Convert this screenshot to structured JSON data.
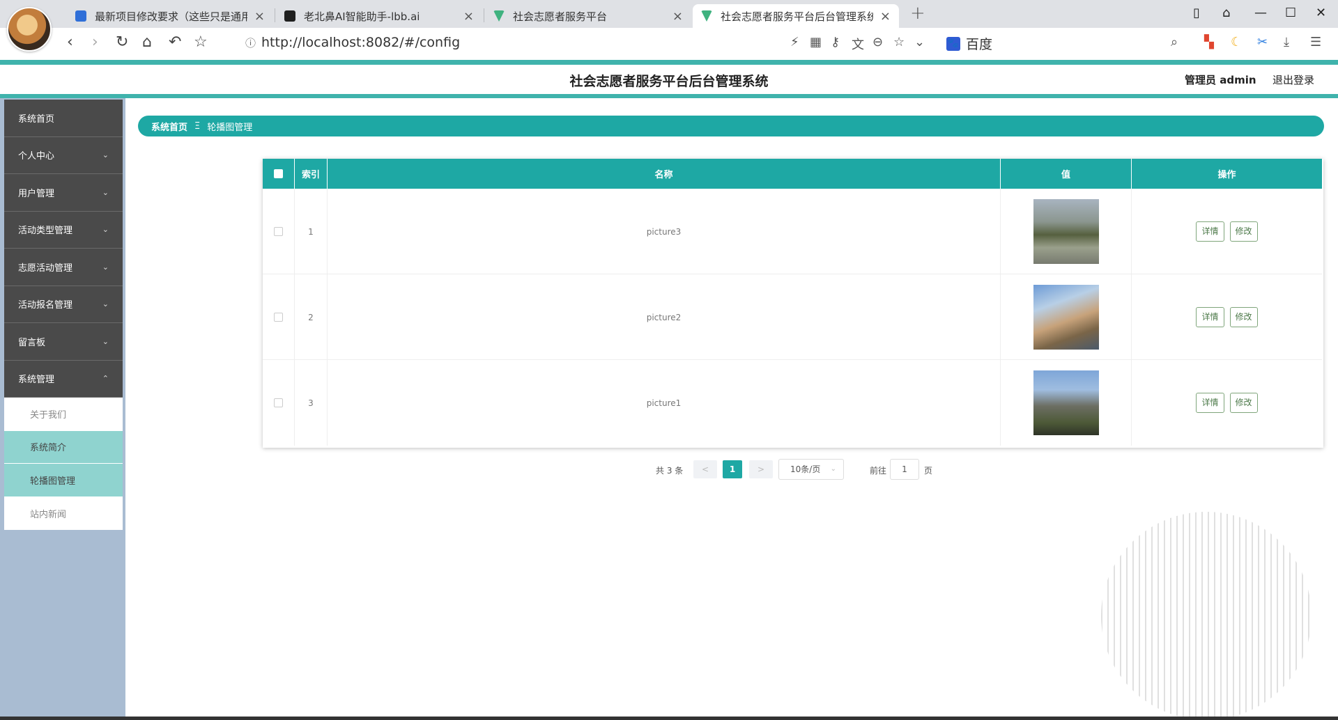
{
  "browser": {
    "tabs": [
      {
        "title": "最新项目修改要求（这些只是通用",
        "favicon_color": "#2f6fd8",
        "active": false
      },
      {
        "title": "老北鼻AI智能助手-lbb.ai",
        "favicon_color": "#1f1f1f",
        "active": false
      },
      {
        "title": "社会志愿者服务平台",
        "favicon_color": "#3fb27f",
        "active": false
      },
      {
        "title": "社会志愿者服务平台后台管理系统",
        "favicon_color": "#3fb27f",
        "active": true
      }
    ],
    "url": "http://localhost:8082/#/config",
    "search_engine": "百度"
  },
  "header": {
    "title": "社会志愿者服务平台后台管理系统",
    "user_label": "管理员 admin",
    "logout_label": "退出登录"
  },
  "sidebar": {
    "items": [
      {
        "label": "系统首页",
        "has_children": false
      },
      {
        "label": "个人中心",
        "has_children": true
      },
      {
        "label": "用户管理",
        "has_children": true
      },
      {
        "label": "活动类型管理",
        "has_children": true
      },
      {
        "label": "志愿活动管理",
        "has_children": true
      },
      {
        "label": "活动报名管理",
        "has_children": true
      },
      {
        "label": "留言板",
        "has_children": true
      },
      {
        "label": "系统管理",
        "has_children": true,
        "expanded": true
      }
    ],
    "sub_items": [
      {
        "label": "关于我们",
        "highlighted": false
      },
      {
        "label": "系统简介",
        "highlighted": true
      },
      {
        "label": "轮播图管理",
        "highlighted": true
      },
      {
        "label": "站内新闻",
        "highlighted": false
      }
    ]
  },
  "breadcrumb": {
    "home": "系统首页",
    "separator": "Ξ",
    "current": "轮播图管理"
  },
  "table": {
    "columns": [
      "索引",
      "名称",
      "值",
      "操作"
    ],
    "rows": [
      {
        "index": "1",
        "name": "picture3",
        "image": "building-road"
      },
      {
        "index": "2",
        "name": "picture2",
        "image": "campus-building"
      },
      {
        "index": "3",
        "name": "picture1",
        "image": "tall-building"
      }
    ],
    "actions": {
      "detail": "详情",
      "edit": "修改"
    }
  },
  "pagination": {
    "total": "共 3 条",
    "prev": "<",
    "current": "1",
    "next": ">",
    "page_size": "10条/页",
    "goto": "前往",
    "page_input": "1",
    "page_unit": "页"
  },
  "colors": {
    "accent": "#1ea8a4",
    "sidebar_dark": "#4a4a4a",
    "sidebar_bg": "#a9bcd2",
    "highlight": "#8fd3cf"
  }
}
